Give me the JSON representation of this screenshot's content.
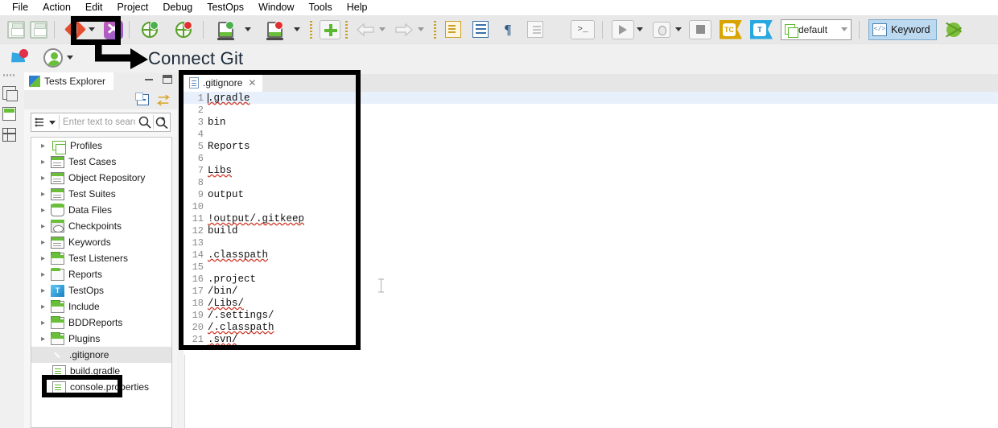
{
  "app": {
    "annotation_label": "Connect Git",
    "annotation_arrow": "arrow-from-git-button-to-label"
  },
  "menubar": {
    "items": [
      {
        "label": "File"
      },
      {
        "label": "Action"
      },
      {
        "label": "Edit"
      },
      {
        "label": "Project"
      },
      {
        "label": "Debug"
      },
      {
        "label": "TestOps"
      },
      {
        "label": "Window"
      },
      {
        "label": "Tools"
      },
      {
        "label": "Help"
      }
    ]
  },
  "toolbar": {
    "items": [
      {
        "name": "save-button",
        "icon": "save-icon"
      },
      {
        "name": "save-all-button",
        "icon": "save-all-icon"
      },
      {
        "name": "git-button",
        "icon": "git-icon",
        "has_dropdown": true
      },
      {
        "name": "katalon-studio-button",
        "icon": "katalon-icon"
      },
      {
        "name": "web-record-button",
        "icon": "globe-green-icon"
      },
      {
        "name": "web-spy-button",
        "icon": "globe-red-icon"
      },
      {
        "name": "mobile-record-button",
        "icon": "device-green-icon",
        "has_dropdown": true
      },
      {
        "name": "mobile-spy-button",
        "icon": "device-red-icon",
        "has_dropdown": true
      },
      {
        "name": "new-item-button",
        "icon": "plus-icon"
      },
      {
        "name": "back-button",
        "icon": "arrow-left-icon",
        "has_dropdown": true,
        "disabled": true
      },
      {
        "name": "forward-button",
        "icon": "arrow-right-icon",
        "has_dropdown": true,
        "disabled": true
      },
      {
        "name": "import-button",
        "icon": "document-import-icon"
      },
      {
        "name": "properties-button",
        "icon": "document-lines-icon"
      },
      {
        "name": "paragraph-button",
        "icon": "pilcrow-icon"
      },
      {
        "name": "outline-button",
        "icon": "document-outline-icon",
        "disabled": true
      },
      {
        "name": "console-button",
        "icon": "terminal-icon"
      },
      {
        "name": "run-button",
        "icon": "play-icon",
        "has_dropdown": true
      },
      {
        "name": "debug-button",
        "icon": "bug-icon",
        "has_dropdown": true
      },
      {
        "name": "stop-button",
        "icon": "stop-square-icon"
      },
      {
        "name": "testcomplete-button",
        "icon": "tc-flag-icon",
        "label": "TC"
      },
      {
        "name": "testops-button",
        "icon": "t-flag-icon",
        "label": "T"
      },
      {
        "name": "profile-selector",
        "value": "default",
        "icon": "copy-icon"
      },
      {
        "name": "keyword-button",
        "label": "Keyword",
        "icon": "code-window-icon"
      },
      {
        "name": "debug-green-button",
        "icon": "bug-green-icon"
      }
    ],
    "profile_value": "default",
    "keyword_label": "Keyword",
    "tc_label": "TC",
    "t_label": "T"
  },
  "toolbar2": {
    "items": [
      {
        "name": "notifications-button",
        "icon": "bell-icon",
        "badge": true
      },
      {
        "name": "account-button",
        "icon": "user-avatar-icon",
        "has_dropdown": true
      }
    ]
  },
  "rail": {
    "items": [
      {
        "name": "restore-views-icon",
        "icon": "window-restore-icon"
      },
      {
        "name": "tests-explorer-icon",
        "icon": "explorer-icon"
      },
      {
        "name": "table-view-icon",
        "icon": "grid-icon"
      }
    ]
  },
  "panel": {
    "tab_title": "Tests Explorer",
    "minimize_label": "Minimize",
    "maximize_label": "Maximize",
    "collapse_all_label": "Collapse All",
    "link_editor_label": "Link with Editor",
    "search_placeholder": "Enter text to search",
    "search_value": "",
    "filter_label": "Filter",
    "search_icon": "magnifier-icon",
    "advanced_search_icon": "magnifier-plus-icon"
  },
  "tree": {
    "items": [
      {
        "label": "Profiles",
        "icon": "profiles-icon",
        "expandable": true,
        "selected": false
      },
      {
        "label": "Test Cases",
        "icon": "test-cases-icon",
        "expandable": true,
        "selected": false
      },
      {
        "label": "Object Repository",
        "icon": "object-repository-icon",
        "expandable": true,
        "selected": false
      },
      {
        "label": "Test Suites",
        "icon": "test-suites-icon",
        "expandable": true,
        "selected": false
      },
      {
        "label": "Data Files",
        "icon": "data-files-icon",
        "expandable": true,
        "selected": false
      },
      {
        "label": "Checkpoints",
        "icon": "checkpoints-icon",
        "expandable": true,
        "selected": false
      },
      {
        "label": "Keywords",
        "icon": "keywords-icon",
        "expandable": true,
        "selected": false
      },
      {
        "label": "Test Listeners",
        "icon": "test-listeners-icon",
        "expandable": true,
        "selected": false
      },
      {
        "label": "Reports",
        "icon": "reports-icon",
        "expandable": true,
        "selected": false
      },
      {
        "label": "TestOps",
        "icon": "testops-icon",
        "expandable": true,
        "selected": false
      },
      {
        "label": "Include",
        "icon": "folder-icon",
        "expandable": true,
        "selected": false
      },
      {
        "label": "BDDReports",
        "icon": "folder-icon",
        "expandable": true,
        "selected": false
      },
      {
        "label": "Plugins",
        "icon": "folder-icon",
        "expandable": true,
        "selected": false
      },
      {
        "label": ".gitignore",
        "icon": "git-file-icon",
        "expandable": false,
        "selected": true
      },
      {
        "label": "build.gradle",
        "icon": "file-icon",
        "expandable": false,
        "selected": false
      },
      {
        "label": "console.properties",
        "icon": "file-icon",
        "expandable": false,
        "selected": false
      }
    ]
  },
  "editor": {
    "tab_label": ".gitignore",
    "tab_icon": "text-file-icon",
    "close_label": "✕",
    "lines": [
      {
        "n": "1",
        "text": ".gradle",
        "spell": true,
        "highlight": true,
        "caret": true
      },
      {
        "n": "2",
        "text": "",
        "spell": false,
        "highlight": false,
        "caret": false
      },
      {
        "n": "3",
        "text": "bin",
        "spell": false,
        "highlight": false,
        "caret": false
      },
      {
        "n": "4",
        "text": "",
        "spell": false,
        "highlight": false,
        "caret": false
      },
      {
        "n": "5",
        "text": "Reports",
        "spell": false,
        "highlight": false,
        "caret": false
      },
      {
        "n": "6",
        "text": "",
        "spell": false,
        "highlight": false,
        "caret": false
      },
      {
        "n": "7",
        "text": "Libs",
        "spell": true,
        "highlight": false,
        "caret": false
      },
      {
        "n": "8",
        "text": "",
        "spell": false,
        "highlight": false,
        "caret": false
      },
      {
        "n": "9",
        "text": "output",
        "spell": false,
        "highlight": false,
        "caret": false
      },
      {
        "n": "10",
        "text": "",
        "spell": false,
        "highlight": false,
        "caret": false
      },
      {
        "n": "11",
        "text": "!output/.gitkeep",
        "spell": true,
        "highlight": false,
        "caret": false
      },
      {
        "n": "12",
        "text": "build",
        "spell": false,
        "highlight": false,
        "caret": false
      },
      {
        "n": "13",
        "text": "",
        "spell": false,
        "highlight": false,
        "caret": false
      },
      {
        "n": "14",
        "text": ".classpath",
        "spell": true,
        "highlight": false,
        "caret": false
      },
      {
        "n": "15",
        "text": "",
        "spell": false,
        "highlight": false,
        "caret": false
      },
      {
        "n": "16",
        "text": ".project",
        "spell": false,
        "highlight": false,
        "caret": false
      },
      {
        "n": "17",
        "text": "/bin/",
        "spell": false,
        "highlight": false,
        "caret": false
      },
      {
        "n": "18",
        "text": "/Libs/",
        "spell": true,
        "highlight": false,
        "caret": false
      },
      {
        "n": "19",
        "text": "/.settings/",
        "spell": false,
        "highlight": false,
        "caret": false
      },
      {
        "n": "20",
        "text": "/.classpath",
        "spell": true,
        "highlight": false,
        "caret": false
      },
      {
        "n": "21",
        "text": ".svn/",
        "spell": true,
        "highlight": false,
        "caret": false
      }
    ]
  },
  "colors": {
    "git_red": "#e44c30",
    "green": "#6abf3a",
    "accent_blue": "#3b6fa8",
    "highlight_line": "#e8f0fb",
    "annotation": "#000000",
    "toolbar_bg": "#e8e8e8"
  }
}
